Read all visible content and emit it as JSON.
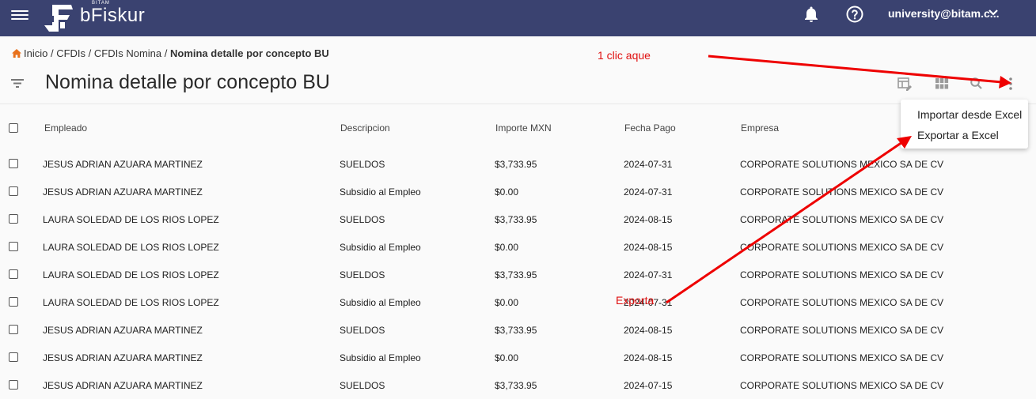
{
  "header": {
    "brand_small": "BITAM",
    "brand": "bFiskur",
    "user": "university@bitam.c..."
  },
  "breadcrumb": {
    "items": [
      "Inicio",
      "CFDIs",
      "CFDIs Nomina"
    ],
    "separator": " / ",
    "current": "Nomina detalle por concepto BU"
  },
  "page": {
    "title": "Nomina detalle por concepto BU"
  },
  "table": {
    "columns": [
      "Empleado",
      "Descripcion",
      "Importe MXN",
      "Fecha Pago",
      "Empresa"
    ],
    "rows": [
      [
        "JESUS ADRIAN AZUARA MARTINEZ",
        "SUELDOS",
        "$3,733.95",
        "2024-07-31",
        "CORPORATE SOLUTIONS MEXICO SA DE CV"
      ],
      [
        "JESUS ADRIAN AZUARA MARTINEZ",
        "Subsidio al Empleo",
        "$0.00",
        "2024-07-31",
        "CORPORATE SOLUTIONS MEXICO SA DE CV"
      ],
      [
        "LAURA SOLEDAD DE LOS RIOS LOPEZ",
        "SUELDOS",
        "$3,733.95",
        "2024-08-15",
        "CORPORATE SOLUTIONS MEXICO SA DE CV"
      ],
      [
        "LAURA SOLEDAD DE LOS RIOS LOPEZ",
        "Subsidio al Empleo",
        "$0.00",
        "2024-08-15",
        "CORPORATE SOLUTIONS MEXICO SA DE CV"
      ],
      [
        "LAURA SOLEDAD DE LOS RIOS LOPEZ",
        "SUELDOS",
        "$3,733.95",
        "2024-07-31",
        "CORPORATE SOLUTIONS MEXICO SA DE CV"
      ],
      [
        "LAURA SOLEDAD DE LOS RIOS LOPEZ",
        "Subsidio al Empleo",
        "$0.00",
        "2024-07-31",
        "CORPORATE SOLUTIONS MEXICO SA DE CV"
      ],
      [
        "JESUS ADRIAN AZUARA MARTINEZ",
        "SUELDOS",
        "$3,733.95",
        "2024-08-15",
        "CORPORATE SOLUTIONS MEXICO SA DE CV"
      ],
      [
        "JESUS ADRIAN AZUARA MARTINEZ",
        "Subsidio al Empleo",
        "$0.00",
        "2024-08-15",
        "CORPORATE SOLUTIONS MEXICO SA DE CV"
      ],
      [
        "JESUS ADRIAN AZUARA MARTINEZ",
        "SUELDOS",
        "$3,733.95",
        "2024-07-15",
        "CORPORATE SOLUTIONS MEXICO SA DE CV"
      ]
    ]
  },
  "menu": {
    "items": [
      "Importar desde Excel",
      "Exportar a Excel"
    ]
  },
  "annotations": {
    "click_note": "1 clic aque",
    "export_note": "Exporta"
  },
  "icons": [
    "menu-icon",
    "logo-icon",
    "bell-icon",
    "help-icon",
    "chevron-down-icon",
    "home-icon",
    "filter-icon",
    "table-edit-icon",
    "grid-icon",
    "search-icon",
    "more-vert-icon"
  ],
  "colors": {
    "topbar": "#3a4270",
    "home_icon": "#e8711c",
    "annotation": "#e01010"
  }
}
